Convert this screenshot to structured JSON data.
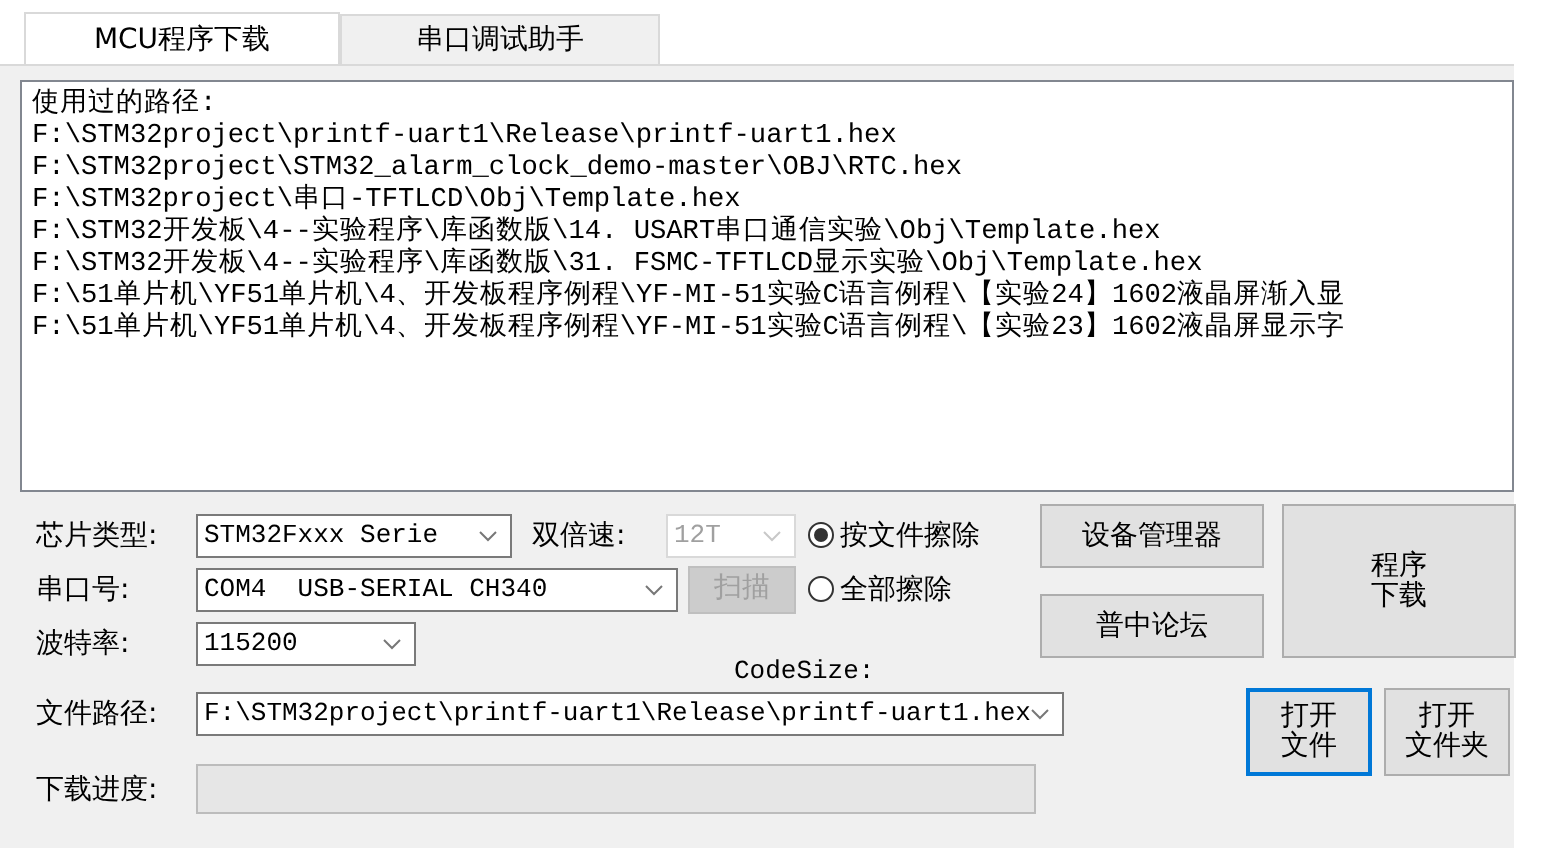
{
  "tabs": [
    {
      "label": "MCU程序下载",
      "selected": true
    },
    {
      "label": "串口调试助手",
      "selected": false
    }
  ],
  "history": {
    "title": "使用过的路径:",
    "paths": [
      "F:\\STM32project\\printf-uart1\\Release\\printf-uart1.hex",
      "F:\\STM32project\\STM32_alarm_clock_demo-master\\OBJ\\RTC.hex",
      "F:\\STM32project\\串口-TFTLCD\\Obj\\Template.hex",
      "F:\\STM32开发板\\4--实验程序\\库函数版\\14. USART串口通信实验\\Obj\\Template.hex",
      "F:\\STM32开发板\\4--实验程序\\库函数版\\31. FSMC-TFTLCD显示实验\\Obj\\Template.hex",
      "F:\\51单片机\\YF51单片机\\4、开发板程序例程\\YF-MI-51实验C语言例程\\【实验24】1602液晶屏渐入显",
      "F:\\51单片机\\YF51单片机\\4、开发板程序例程\\YF-MI-51实验C语言例程\\【实验23】1602液晶屏显示字"
    ]
  },
  "chip_type": {
    "label": "芯片类型:",
    "value": "STM32Fxxx Serie"
  },
  "double_speed": {
    "label": "双倍速:",
    "value": "12T",
    "disabled": true
  },
  "erase_options": [
    {
      "label": "按文件擦除",
      "selected": true
    },
    {
      "label": "全部擦除",
      "selected": false
    }
  ],
  "device_manager_button": "设备管理器",
  "forum_button": "普中论坛",
  "download_button": [
    "程序",
    "下载"
  ],
  "com_port": {
    "label": "串口号:",
    "value": "COM4  USB-SERIAL CH340"
  },
  "scan_button": {
    "label": "扫描",
    "disabled": true
  },
  "baud_rate": {
    "label": "波特率:",
    "value": "115200"
  },
  "code_size_label": "CodeSize:",
  "file_path": {
    "label": "文件路径:",
    "value": "F:\\STM32project\\printf-uart1\\Release\\printf-uart1.hex"
  },
  "open_file_button": {
    "label": [
      "打开",
      "文件"
    ],
    "focused": true
  },
  "open_folder_button": {
    "label": [
      "打开",
      "文件夹"
    ],
    "focused": false
  },
  "progress": {
    "label": "下载进度:",
    "level": 0
  }
}
